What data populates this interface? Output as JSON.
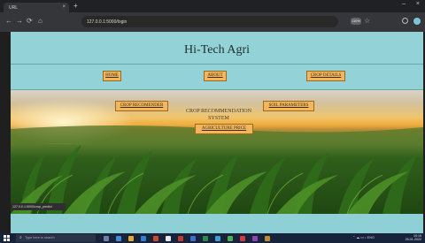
{
  "browser": {
    "tab_title": "URL",
    "tab_close": "×",
    "new_tab": "+",
    "minimize": "–",
    "close": "×",
    "nav": {
      "back": "←",
      "forward": "→",
      "reload": "⟳",
      "home": "⌂"
    },
    "address_host": "127.0.0.1",
    "address_path": ":5000/login",
    "zoom": "110%",
    "bookmark_icon": "star-icon"
  },
  "page": {
    "site_title": "Hi-Tech Agri",
    "nav": {
      "home": "HOME",
      "about": "ABOUT",
      "crop_details": "CROP DETAILS"
    },
    "hero": {
      "title": "CROP RECOMMENDATION SYSTEM",
      "crop_recommender": "CROP RECOMENDER",
      "soil_parameters": "SOIL PARAMETERS",
      "agriculture_price": "AGRICULTURE PRICE"
    },
    "status_bar_url": "127.0.0.1:5000/crop_predict"
  },
  "taskbar": {
    "search_placeholder": "Type here to search",
    "time": "10:15",
    "date": "25-01-2022"
  },
  "colors": {
    "page_bg": "#8fd0d6",
    "button_bg": "#f3b65c",
    "taskbar_bg": "#17223b"
  }
}
